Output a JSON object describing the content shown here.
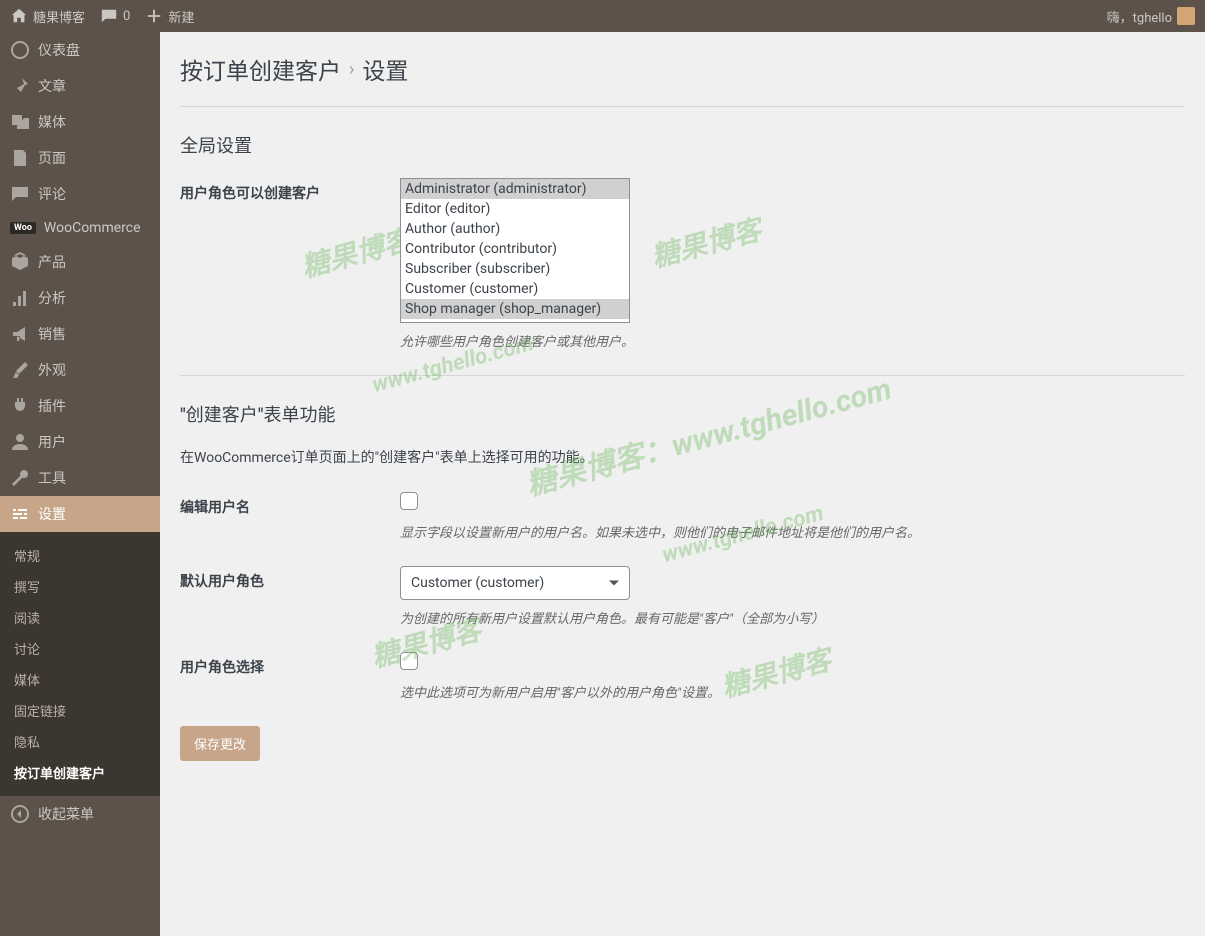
{
  "topbar": {
    "site_name": "糖果博客",
    "comments_count": "0",
    "new_label": "新建",
    "greeting": "嗨，tghello"
  },
  "sidebar": {
    "items": [
      {
        "label": "仪表盘",
        "icon": "dash"
      },
      {
        "label": "文章",
        "icon": "pin"
      },
      {
        "label": "媒体",
        "icon": "media"
      },
      {
        "label": "页面",
        "icon": "page"
      },
      {
        "label": "评论",
        "icon": "comment"
      },
      {
        "label": "WooCommerce",
        "icon": "wc"
      },
      {
        "label": "产品",
        "icon": "product"
      },
      {
        "label": "分析",
        "icon": "chart"
      },
      {
        "label": "销售",
        "icon": "mega"
      },
      {
        "label": "外观",
        "icon": "brush"
      },
      {
        "label": "插件",
        "icon": "plug"
      },
      {
        "label": "用户",
        "icon": "user"
      },
      {
        "label": "工具",
        "icon": "wrench"
      },
      {
        "label": "设置",
        "icon": "settings"
      }
    ],
    "settings_submenu": [
      "常规",
      "撰写",
      "阅读",
      "讨论",
      "媒体",
      "固定链接",
      "隐私",
      "按订单创建客户"
    ],
    "collapse_label": "收起菜单"
  },
  "page": {
    "title_main": "按订单创建客户",
    "title_sub": "设置",
    "global_section": "全局设置",
    "roles_label": "用户角色可以创建客户",
    "roles_options": [
      {
        "text": "Administrator (administrator)",
        "selected": true
      },
      {
        "text": "Editor (editor)",
        "selected": false
      },
      {
        "text": "Author (author)",
        "selected": false
      },
      {
        "text": "Contributor (contributor)",
        "selected": false
      },
      {
        "text": "Subscriber (subscriber)",
        "selected": false
      },
      {
        "text": "Customer (customer)",
        "selected": false
      },
      {
        "text": "Shop manager (shop_manager)",
        "selected": true
      }
    ],
    "roles_desc": "允许哪些用户角色创建客户或其他用户。",
    "form_section": "\"创建客户\"表单功能",
    "form_section_desc": "在WooCommerce订单页面上的\"创建客户\"表单上选择可用的功能。",
    "edit_username_label": "编辑用户名",
    "edit_username_desc": "显示字段以设置新用户的用户名。如果未选中，则他们的电子邮件地址将是他们的用户名。",
    "default_role_label": "默认用户角色",
    "default_role_value": "Customer (customer)",
    "default_role_desc": "为创建的所有新用户设置默认用户角色。最有可能是\"客户\"（全部为小写）",
    "role_select_label": "用户角色选择",
    "role_select_desc": "选中此选项可为新用户启用\"客户以外的用户角色\"设置。",
    "save_btn": "保存更改"
  },
  "watermarks": [
    "糖果博客",
    "www.tghello.com",
    "糖果博客：www.tghello.com",
    "糖果博客",
    "www.tghello.com",
    "糖果博客",
    "糖果博客"
  ]
}
